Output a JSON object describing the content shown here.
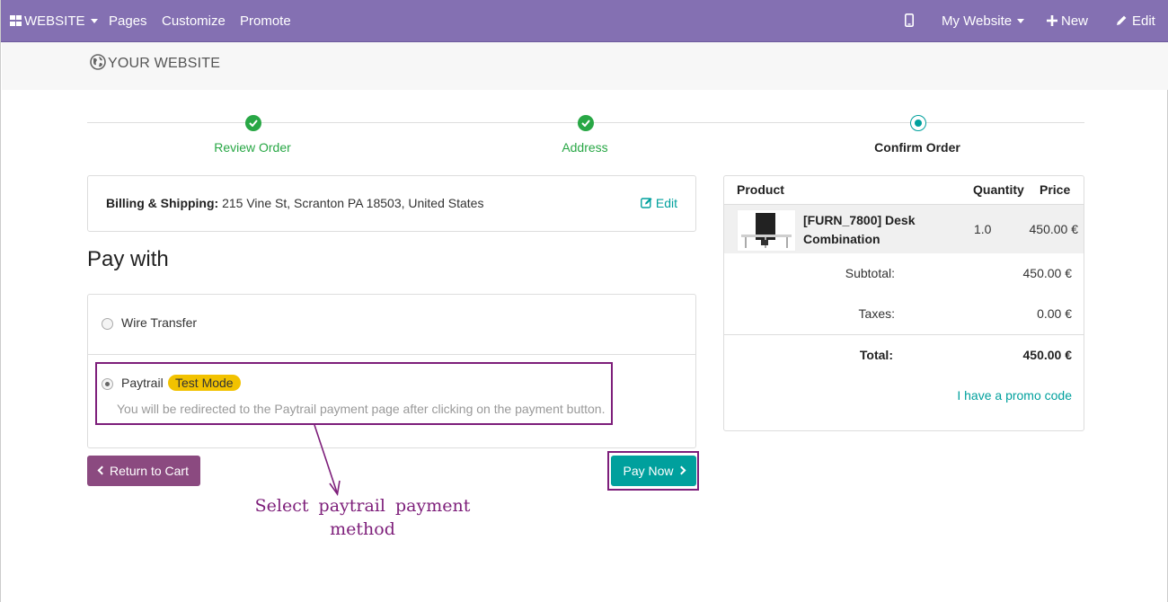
{
  "topbar": {
    "app_label": "WEBSITE",
    "menu": [
      "Pages",
      "Customize",
      "Promote"
    ],
    "site_selector": "My Website",
    "new_label": "New",
    "edit_label": "Edit",
    "bg_color": "#8470b2"
  },
  "header": {
    "brand": "YOUR WEBSITE"
  },
  "wizard": {
    "steps": [
      {
        "label": "Review Order",
        "state": "done"
      },
      {
        "label": "Address",
        "state": "done"
      },
      {
        "label": "Confirm Order",
        "state": "current"
      }
    ]
  },
  "billing": {
    "label": "Billing & Shipping:",
    "address": "215 Vine St, Scranton PA 18503, United States",
    "edit_label": "Edit"
  },
  "payment": {
    "title": "Pay with",
    "methods": [
      {
        "label": "Wire Transfer",
        "selected": false
      },
      {
        "label": "Paytrail",
        "selected": true,
        "badge": "Test Mode",
        "help": "You will be redirected to the Paytrail payment page after clicking on the payment button."
      }
    ],
    "return_label": "Return to Cart",
    "pay_label": "Pay Now"
  },
  "annotation": {
    "line1": "Select paytrail payment",
    "line2": "method",
    "color": "#7d1e7a"
  },
  "summary": {
    "headers": {
      "product": "Product",
      "quantity": "Quantity",
      "price": "Price"
    },
    "item": {
      "name_line1": "[FURN_7800] Desk",
      "name_line2": "Combination",
      "quantity": "1.0",
      "price": "450.00 €"
    },
    "subtotal_label": "Subtotal:",
    "subtotal": "450.00 €",
    "taxes_label": "Taxes:",
    "taxes": "0.00 €",
    "total_label": "Total:",
    "total": "450.00 €",
    "promo_label": "I have a promo code"
  }
}
